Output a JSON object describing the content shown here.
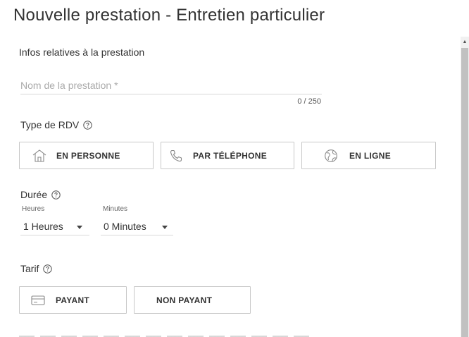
{
  "page": {
    "title": "Nouvelle prestation - Entretien particulier"
  },
  "form": {
    "section_title": "Infos relatives à la prestation",
    "name": {
      "value": "",
      "placeholder": "Nom de la prestation *",
      "counter": "0 / 250"
    },
    "appointment_type": {
      "label": "Type de RDV",
      "help_icon": "question-circle-icon",
      "options": [
        {
          "label": "EN PERSONNE",
          "icon": "home-icon"
        },
        {
          "label": "PAR TÉLÉPHONE",
          "icon": "phone-icon"
        },
        {
          "label": "EN LIGNE",
          "icon": "globe-icon"
        }
      ]
    },
    "duration": {
      "label": "Durée",
      "help_icon": "question-circle-icon",
      "hours": {
        "label": "Heures",
        "value": "1 Heures"
      },
      "minutes": {
        "label": "Minutes",
        "value": "0 Minutes"
      }
    },
    "pricing": {
      "label": "Tarif",
      "help_icon": "question-circle-icon",
      "options": [
        {
          "label": "PAYANT",
          "icon": "credit-card-icon"
        },
        {
          "label": "NON PAYANT"
        }
      ]
    }
  },
  "colors": {
    "border": "#c8c8c8",
    "text": "#333333",
    "placeholder": "#aaaaaa"
  }
}
